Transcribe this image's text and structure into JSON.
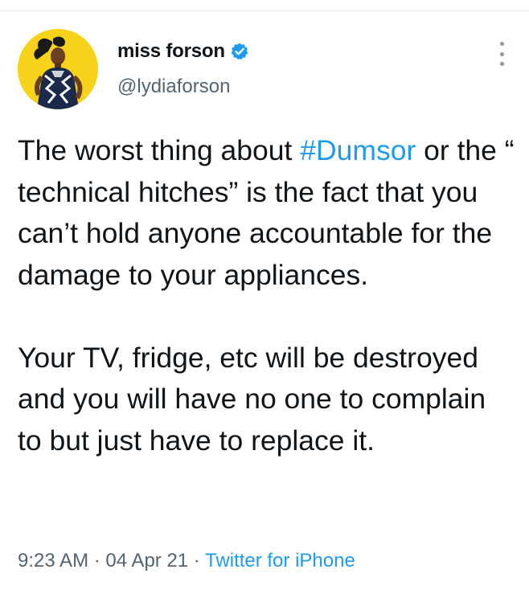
{
  "tweet": {
    "author": {
      "display_name": "miss forson",
      "handle": "@lydiaforson",
      "verified": true,
      "avatar_icon": "profile-photo"
    },
    "text": {
      "p1_before": "The worst thing about ",
      "p1_hashtag": "#Dumsor",
      "p1_after": " or the “ technical hitches”  is the fact that you can’t hold anyone accountable for the damage to your appliances.",
      "p2": "Your TV, fridge, etc will be destroyed and you will have no one to complain to but just have to replace it."
    },
    "meta": {
      "time": "9:23 AM",
      "sep1": " · ",
      "date": "04 Apr 21",
      "sep2": " · ",
      "source": "Twitter for iPhone"
    },
    "more_icon": "more-vertical-icon"
  },
  "colors": {
    "link": "#1d9bf0",
    "text": "#0f1419",
    "muted": "#536471",
    "avatar_bg": "#f7d21b"
  }
}
